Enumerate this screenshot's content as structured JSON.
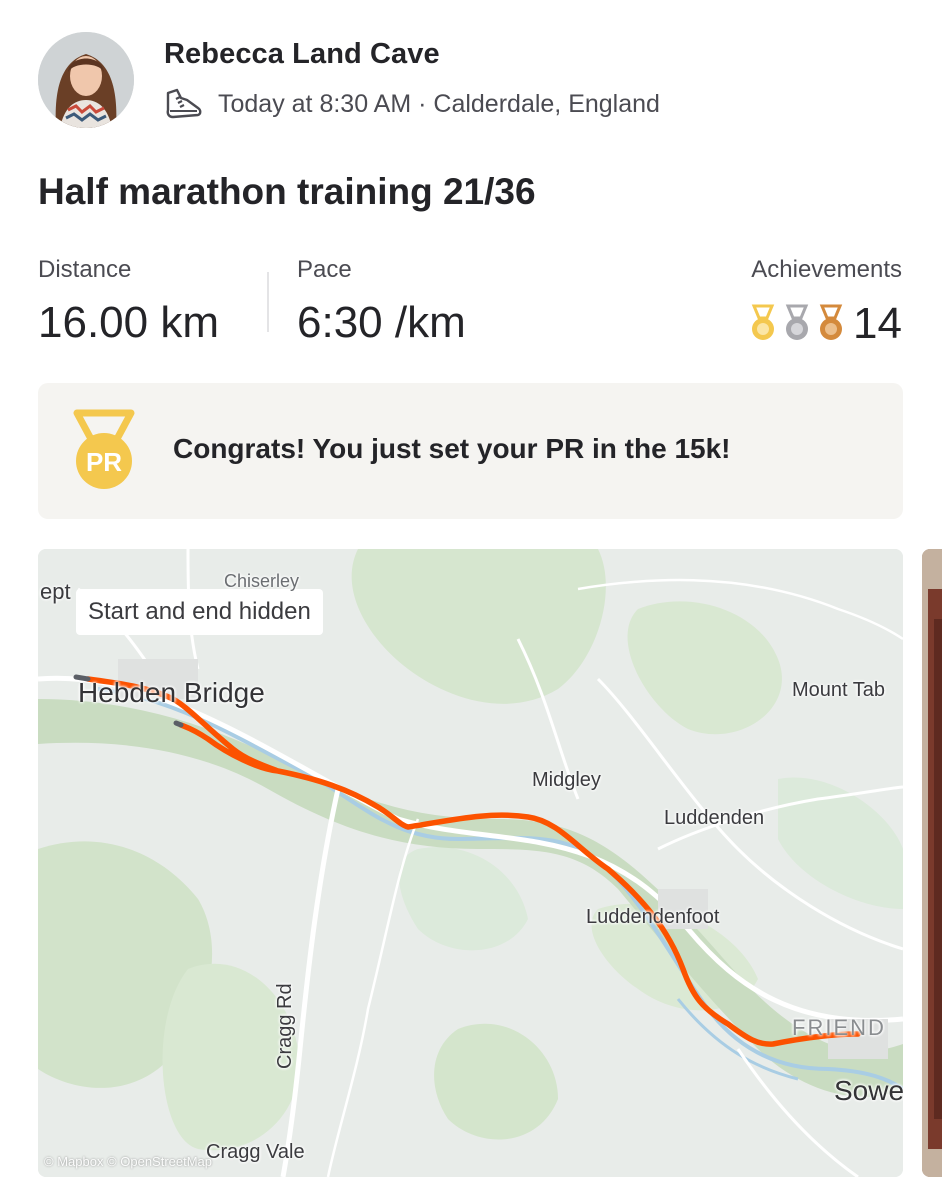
{
  "athlete": {
    "name": "Rebecca Land Cave",
    "meta": "Today at 8:30 AM · Calderdale, England"
  },
  "activity": {
    "title": "Half marathon training 21/36",
    "distance_label": "Distance",
    "distance_value": "16.00 km",
    "pace_label": "Pace",
    "pace_value": "6:30 /km",
    "achievements_label": "Achievements",
    "achievements_count": "14",
    "medals": [
      "gold",
      "silver",
      "bronze"
    ]
  },
  "pr_banner": {
    "badge": "PR",
    "text": "Congrats! You just set your PR in the 15k!"
  },
  "map": {
    "hidden_notice": "Start and end hidden",
    "labels": {
      "hebden_bridge": "Hebden Bridge",
      "heptonstall": "ept",
      "chiserley": "Chiserley",
      "mount_tabor": "Mount Tab",
      "midgley": "Midgley",
      "luddenden": "Luddenden",
      "luddendenfoot": "Luddendenfoot",
      "friendly": "FRIEND",
      "sowerby": "Sowe",
      "cragg_rd": "Cragg Rd",
      "cragg_vale": "Cragg Vale"
    },
    "attribution": "© Mapbox © OpenStreetMap",
    "route_color": "#fc5200"
  },
  "colors": {
    "brand": "#fc5200",
    "gold": "#f4c84e",
    "silver": "#a8a8ad",
    "bronze": "#d48a3c",
    "banner_bg": "#f5f4f1"
  }
}
